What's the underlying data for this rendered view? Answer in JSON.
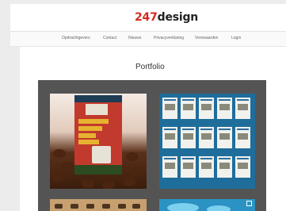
{
  "brand": {
    "logo_number": "247",
    "logo_word": "design"
  },
  "nav": {
    "items": [
      {
        "label": "Opdrachtgevers"
      },
      {
        "label": "Contact"
      },
      {
        "label": "Nieuws"
      },
      {
        "label": "Privacyverklaring"
      },
      {
        "label": "Voorwaarden"
      },
      {
        "label": "Login"
      }
    ]
  },
  "main": {
    "title": "Portfolio"
  },
  "portfolio": {
    "items": [
      {
        "subject": "poster-culinary-event"
      },
      {
        "subject": "brochure-pages-spread"
      },
      {
        "subject": "fish-illustration-chart"
      },
      {
        "subject": "surfer-wave-photo"
      }
    ]
  },
  "colors": {
    "logo_number": "#d52b1e",
    "gallery_background": "#545454",
    "page_background": "#ececec"
  }
}
